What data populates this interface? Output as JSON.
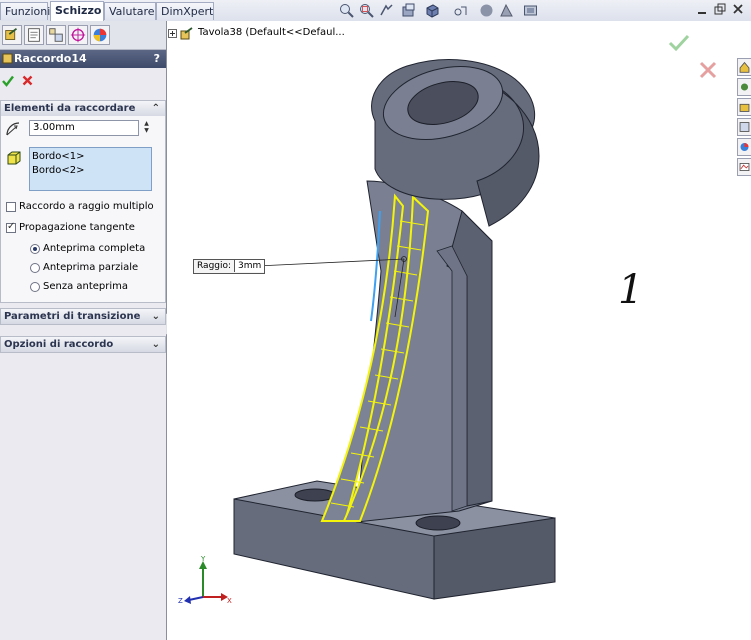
{
  "tabs": [
    "Funzioni",
    "Schizzo",
    "Valutare",
    "DimXpert"
  ],
  "active_tab": "Schizzo",
  "breadcrumb": "Tavola38  (Default<<Defaul...",
  "feature": {
    "title": "Raccordo14",
    "help": "?"
  },
  "items_section": {
    "header": "Elementi da raccordare",
    "radius_value": "3.00mm",
    "edges": [
      "Bordo<1>",
      "Bordo<2>"
    ],
    "multi_radius_label": "Raccordo a raggio multiplo",
    "multi_radius_checked": false,
    "tangent_label": "Propagazione tangente",
    "tangent_checked": true,
    "preview_options": [
      "Anteprima completa",
      "Anteprima parziale",
      "Senza anteprima"
    ],
    "preview_selected": "Anteprima completa"
  },
  "sections_collapsed": [
    "Parametri di transizione",
    "Opzioni di raccordo"
  ],
  "callout": {
    "label": "Raggio:",
    "value": "3mm"
  },
  "annotation_number": "1",
  "triad": {
    "y": "Y",
    "x": "X",
    "z": "Z"
  },
  "colors": {
    "model": "#676d7e",
    "edge_highlight": "#f4f40a",
    "accept": "#2aa22a",
    "reject": "#d82a2a"
  }
}
